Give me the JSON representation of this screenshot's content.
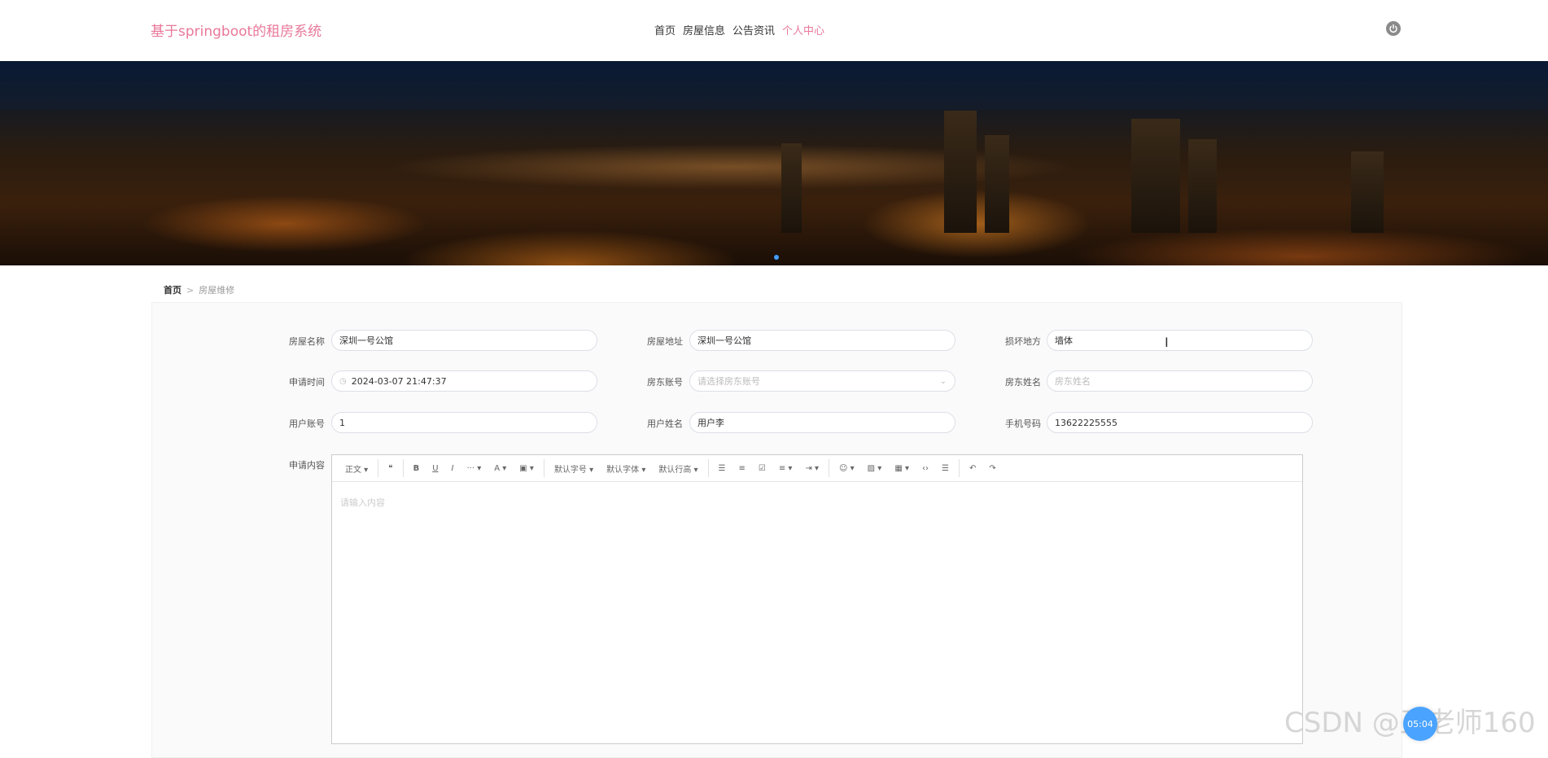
{
  "header": {
    "site_title": "基于springboot的租房系统",
    "nav": [
      "首页",
      "房屋信息",
      "公告资讯",
      "个人中心"
    ],
    "active_nav": "个人中心"
  },
  "breadcrumb": {
    "home": "首页",
    "separator": ">",
    "current": "房屋维修"
  },
  "form": {
    "house_name": {
      "label": "房屋名称",
      "value": "深圳一号公馆"
    },
    "house_address": {
      "label": "房屋地址",
      "value": "深圳一号公馆"
    },
    "damage_location": {
      "label": "损坏地方",
      "value": "墙体"
    },
    "apply_time": {
      "label": "申请时间",
      "value": "2024-03-07 21:47:37"
    },
    "landlord_account": {
      "label": "房东账号",
      "placeholder": "请选择房东账号"
    },
    "landlord_name": {
      "label": "房东姓名",
      "placeholder": "房东姓名"
    },
    "user_account": {
      "label": "用户账号",
      "value": "1"
    },
    "user_name": {
      "label": "用户姓名",
      "value": "用户李"
    },
    "phone": {
      "label": "手机号码",
      "value": "13622225555"
    },
    "content": {
      "label": "申请内容",
      "placeholder": "请输入内容"
    }
  },
  "editor_toolbar": {
    "paragraph": "正文",
    "font_size": "默认字号",
    "font_family": "默认字体",
    "line_height": "默认行高"
  },
  "watermark": "CSDN @王老师160",
  "timer": "05:04",
  "colors": {
    "brand": "#e8789a",
    "active_dot": "#409eff",
    "badge": "#4aa3ff"
  }
}
